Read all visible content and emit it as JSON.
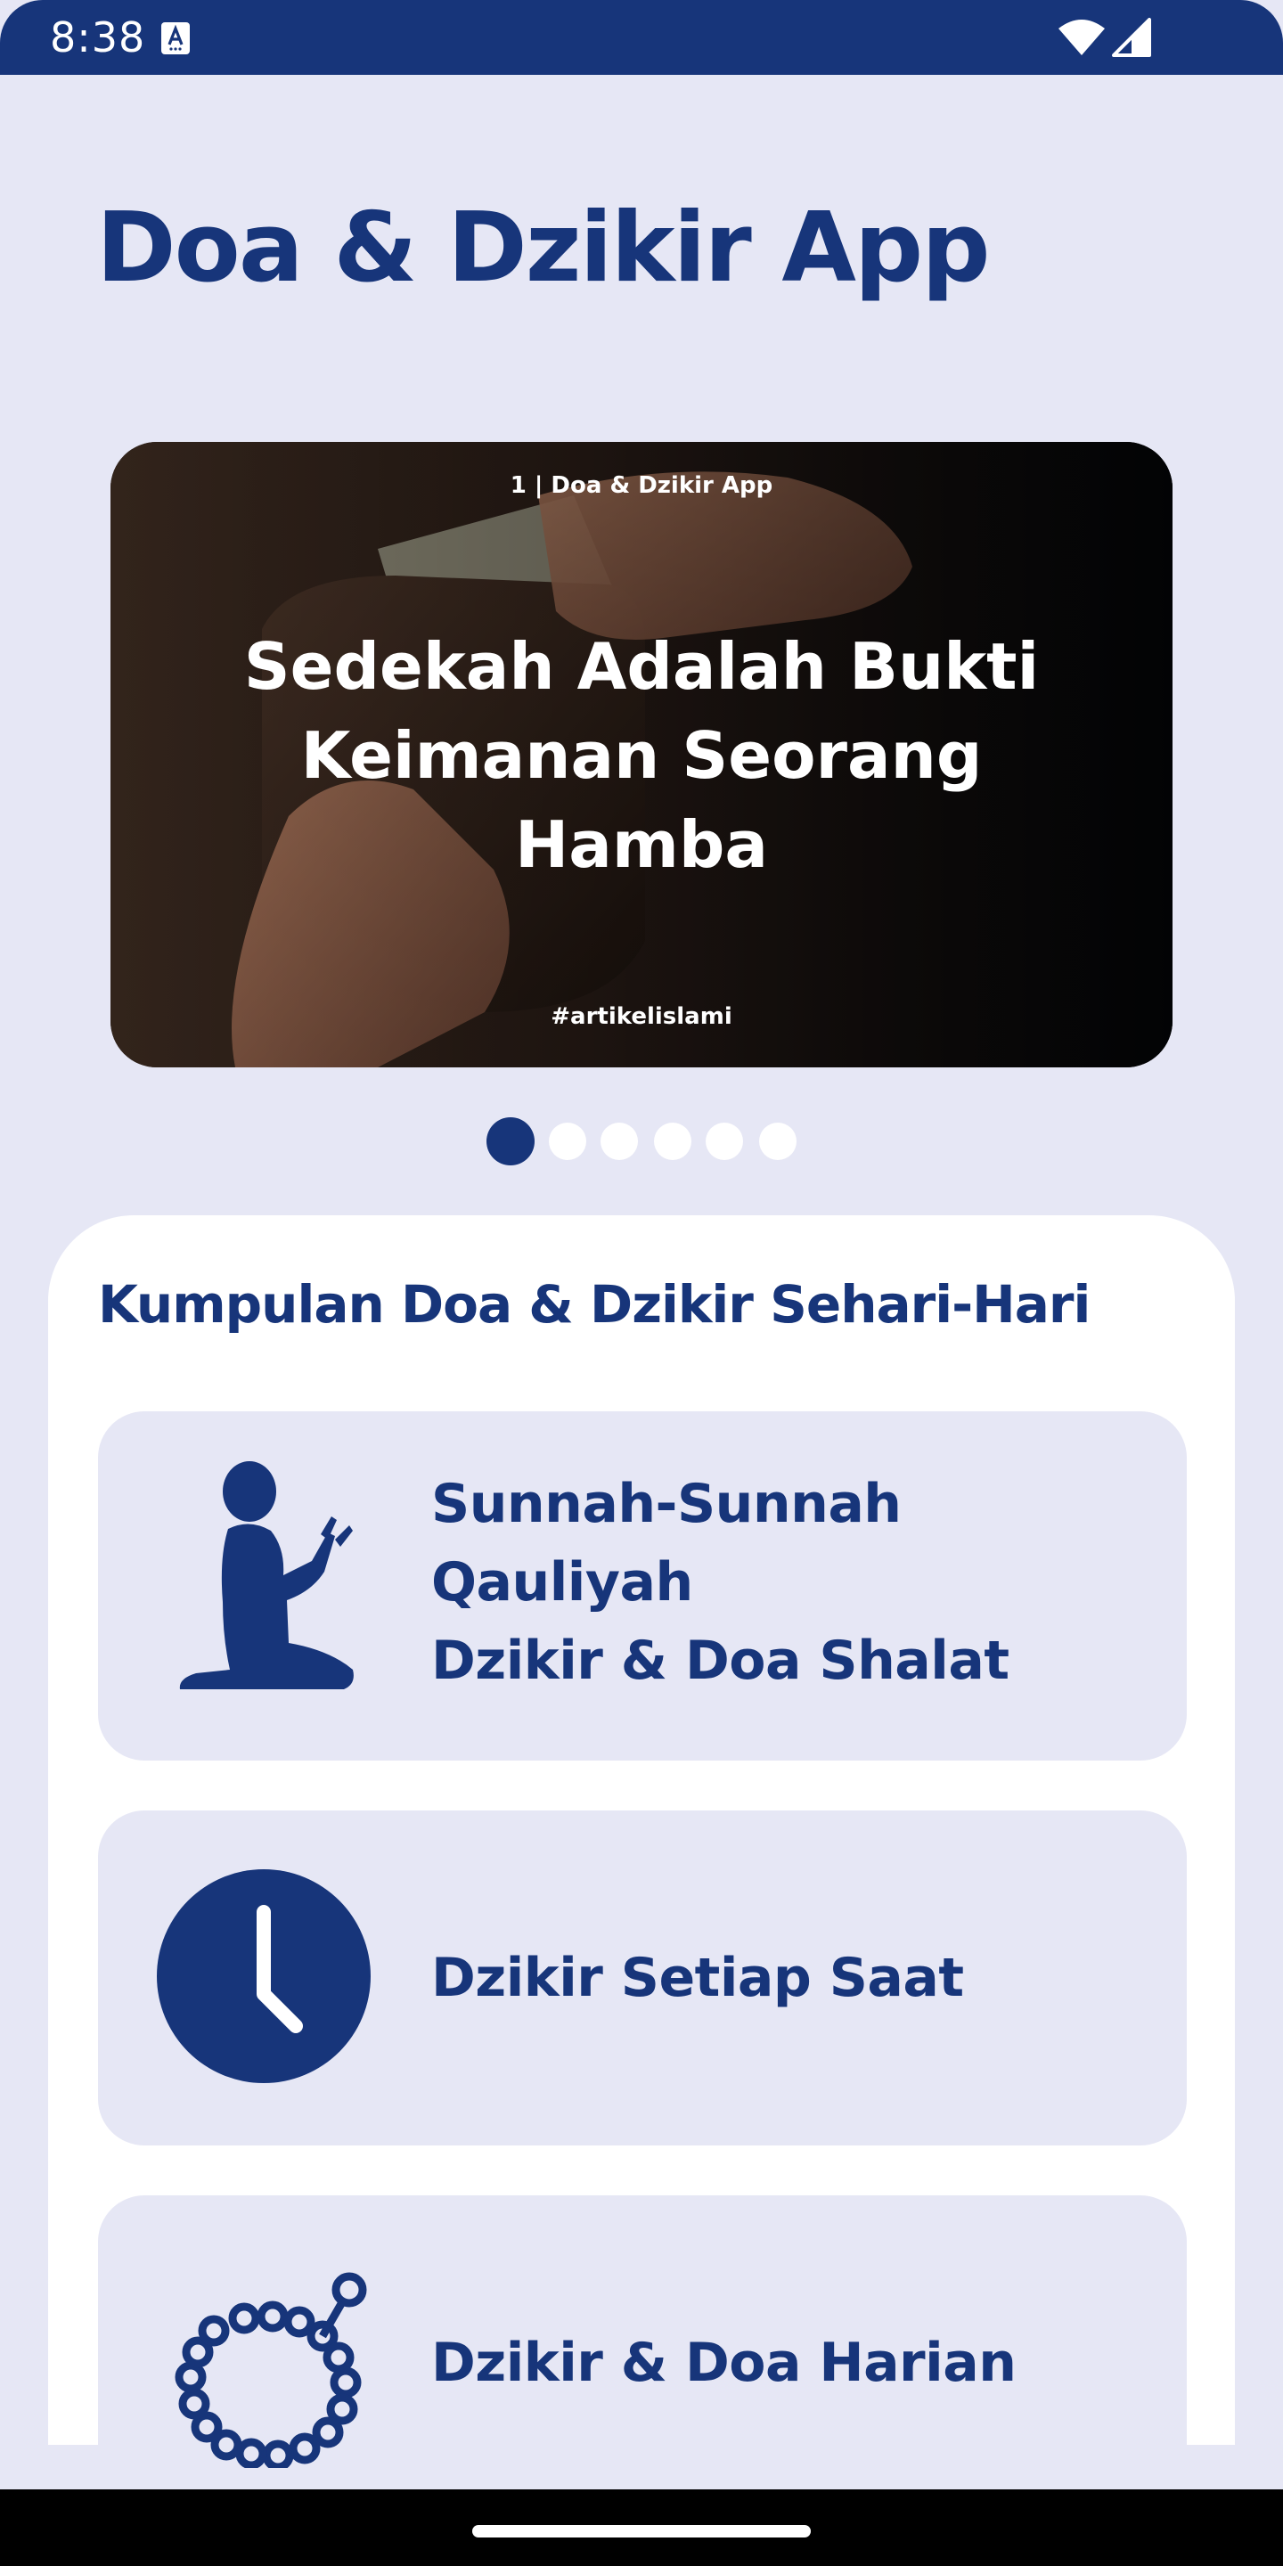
{
  "status_bar": {
    "time": "8:38",
    "icons": [
      "notification-a-icon",
      "wifi-icon",
      "signal-icon"
    ]
  },
  "app": {
    "title": "Doa & Dzikir App"
  },
  "banner": {
    "caption": "1 | Doa & Dzikir App",
    "headline": "Sedekah Adalah Bukti Keimanan Seorang Hamba",
    "hashtag": "#artikelislami",
    "image": "hands-holding-wallet-photo"
  },
  "pager": {
    "count": 6,
    "active_index": 0
  },
  "section": {
    "title": "Kumpulan Doa & Dzikir Sehari-Hari"
  },
  "menu_items": [
    {
      "icon": "praying-person-icon",
      "lines": [
        "Sunnah-Sunnah",
        "Qauliyah",
        "Dzikir & Doa Shalat"
      ]
    },
    {
      "icon": "clock-icon",
      "lines": [
        "Dzikir Setiap Saat"
      ]
    },
    {
      "icon": "prayer-beads-icon",
      "lines": [
        "Dzikir & Doa Harian"
      ]
    }
  ],
  "colors": {
    "primary": "#17357A",
    "background": "#E6E7F5",
    "surface": "#FFFFFF"
  }
}
